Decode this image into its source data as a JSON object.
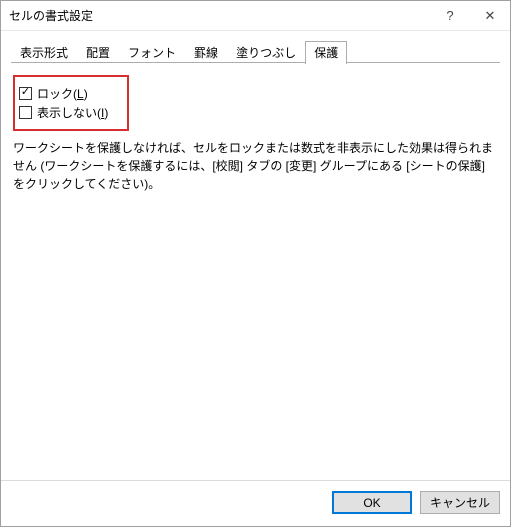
{
  "window": {
    "title": "セルの書式設定"
  },
  "tabs": {
    "items": [
      {
        "label": "表示形式"
      },
      {
        "label": "配置"
      },
      {
        "label": "フォント"
      },
      {
        "label": "罫線"
      },
      {
        "label": "塗りつぶし"
      },
      {
        "label": "保護"
      }
    ],
    "active_index": 5
  },
  "protection": {
    "lock_label_pre": "ロック(",
    "lock_accel": "L",
    "lock_label_post": ")",
    "lock_checked": true,
    "hidden_label_pre": "表示しない(",
    "hidden_accel": "I",
    "hidden_label_post": ")",
    "hidden_checked": false,
    "description": "ワークシートを保護しなければ、セルをロックまたは数式を非表示にした効果は得られません (ワークシートを保護するには、[校閲] タブの [変更] グループにある [シートの保護] をクリックしてください)。"
  },
  "buttons": {
    "ok": "OK",
    "cancel": "キャンセル"
  },
  "icons": {
    "help": "?",
    "close": "✕",
    "check": "✓"
  }
}
